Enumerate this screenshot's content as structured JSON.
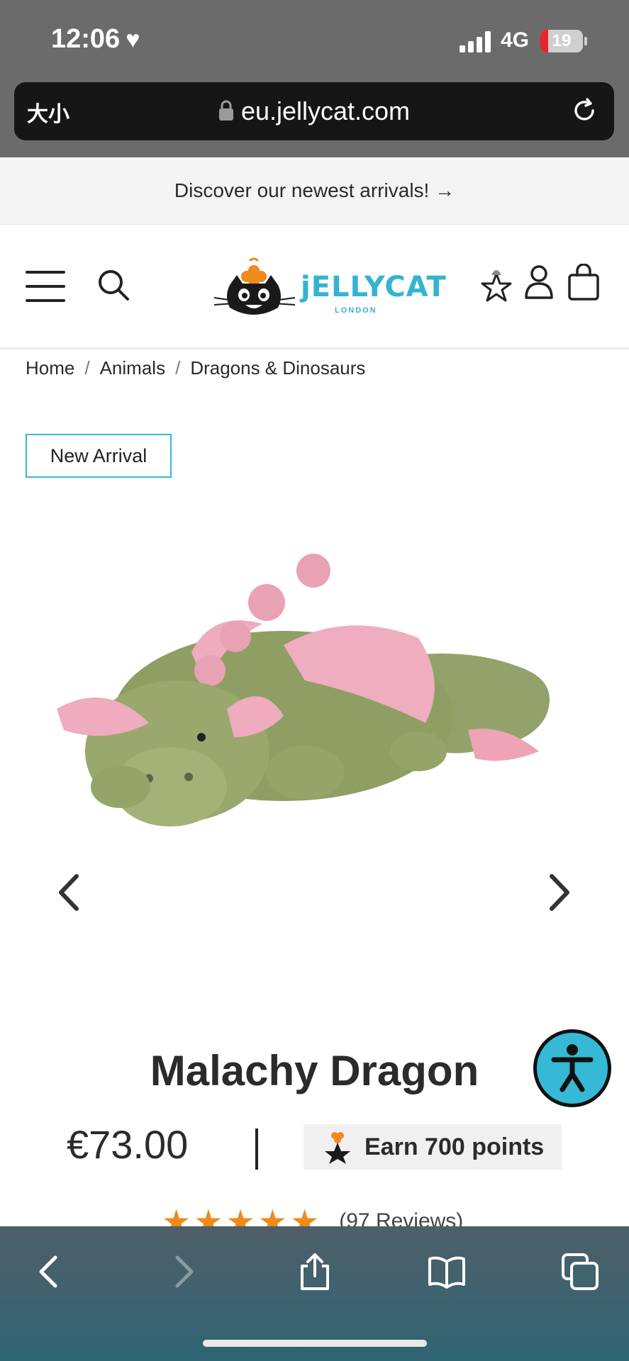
{
  "status_bar": {
    "time": "12:06",
    "network": "4G",
    "battery_percent": "19",
    "battery_level": 0.19
  },
  "browser": {
    "text_size_label": "大小",
    "url": "eu.jellycat.com"
  },
  "promo": {
    "text": "Discover our newest arrivals! →"
  },
  "logo": {
    "wordmark": "jELLYCAT",
    "tagline": "LONDON"
  },
  "breadcrumb": {
    "items": [
      "Home",
      "Animals",
      "Dragons & Dinosaurs"
    ],
    "separator": "/"
  },
  "product": {
    "badge": "New Arrival",
    "image": "green-pink-plush-dragon",
    "title": "Malachy Dragon",
    "price": "€73.00",
    "points_label": "Earn 700 points",
    "rating_stars": 5,
    "reviews_label": "(97 Reviews)"
  },
  "colors": {
    "accent": "#35b9d6",
    "star": "#f08a1a",
    "battery_low": "#e6262a"
  },
  "toolbar": {
    "icons": [
      "back-icon",
      "forward-icon",
      "share-icon",
      "bookmarks-icon",
      "tabs-icon"
    ]
  }
}
